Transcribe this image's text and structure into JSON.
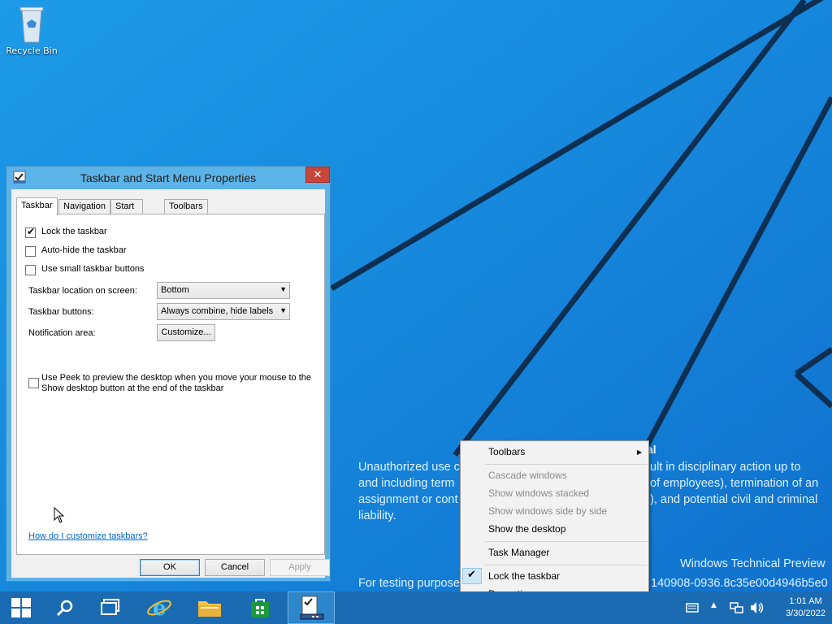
{
  "desktop": {
    "icons": [
      {
        "label": "Recycle Bin",
        "icon": "recycle-bin-icon"
      }
    ],
    "watermark": {
      "title_visible": "al",
      "line1": "Unauthorized use c",
      "line1_right": "ult in disciplinary action up to",
      "line2": "and including term",
      "line2_right": "of employees), termination of an",
      "line3": "assignment or cont",
      "line3_right": "), and potential civil and criminal",
      "line4": "liability.",
      "product": "Windows Technical Preview",
      "build_prefix": "For testing purpose",
      "build_suffix": "140908-0936.8c35e00d4946b5e0"
    }
  },
  "dialog": {
    "title": "Taskbar and Start Menu Properties",
    "close_label": "✕",
    "tabs": [
      "Taskbar",
      "Navigation",
      "Start Menu",
      "Toolbars"
    ],
    "active_tab": "Taskbar",
    "options": {
      "lock_taskbar": "Lock the taskbar",
      "auto_hide": "Auto-hide the taskbar",
      "small_buttons": "Use small taskbar buttons",
      "peek_line1": "Use Peek to preview the desktop when you move your mouse to the",
      "peek_line2": "Show desktop button at the end of the taskbar"
    },
    "location_label": "Taskbar location on screen:",
    "location_value": "Bottom",
    "buttons_label": "Taskbar buttons:",
    "buttons_value": "Always combine, hide labels",
    "notification_label": "Notification area:",
    "customize_label": "Customize...",
    "help_link": "How do I customize taskbars?",
    "ok": "OK",
    "cancel": "Cancel",
    "apply": "Apply"
  },
  "context_menu": {
    "toolbars": "Toolbars",
    "cascade": "Cascade windows",
    "stacked": "Show windows stacked",
    "side_by_side": "Show windows side by side",
    "show_desktop": "Show the desktop",
    "task_manager": "Task Manager",
    "lock": "Lock the taskbar",
    "properties": "Properties"
  },
  "taskbar": {
    "time": "1:01 AM",
    "date": "3/30/2022"
  },
  "colors": {
    "desktop_bg": "#1a8ee0",
    "taskbar": "#1b6bb3",
    "dialog_frame": "#5cb3e8",
    "close_button": "#c7463b"
  }
}
